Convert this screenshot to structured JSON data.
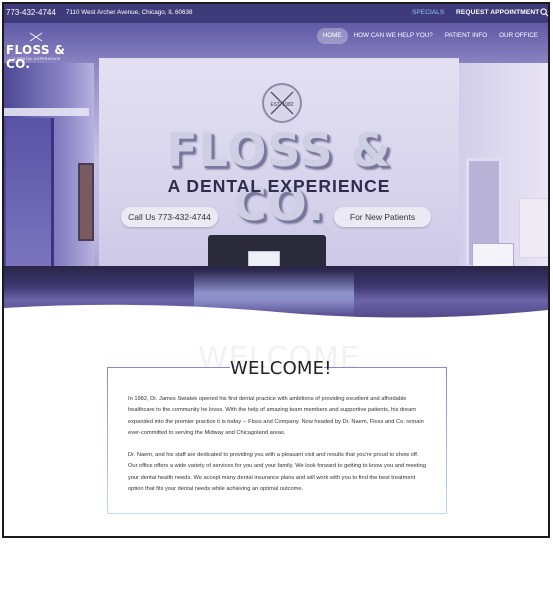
{
  "topbar": {
    "phone": "773-432-4744",
    "address": "7110 West Archer Avenue, Chicago, IL 60638",
    "specials": "SPECIALS",
    "request": "REQUEST APPOINTMENT",
    "specials_color": "#8fc4ff",
    "background": "#3f3a7a"
  },
  "brand": {
    "name": "FLOSS & CO.",
    "tagline": "A DENTAL EXPERIENCE",
    "badge_text": "EST. 1982"
  },
  "nav": {
    "items": [
      {
        "label": "HOME",
        "active": true
      },
      {
        "label": "HOW CAN WE HELP YOU?",
        "active": false
      },
      {
        "label": "PATIENT INFO",
        "active": false
      },
      {
        "label": "OUR OFFICE",
        "active": false
      }
    ]
  },
  "hero": {
    "emblem_text": "EST. 1982",
    "logo_text": "FLOSS & CO.",
    "tagline": "A DENTAL EXPERIENCE",
    "call_button": "Call Us 773-432-4744",
    "new_patients_button": "For New Patients"
  },
  "welcome": {
    "ghost_title": "WELCOME",
    "title": "WELCOME!",
    "paragraphs": [
      "In 1982, Dr. James Swiatek opened his first dental practice with ambitions of providing excellent and affordable healthcare to the community he loves. With the help of amazing team members and supportive patients, his dream expanded into the premier practice it is today -- Floss and Company. Now headed by Dr. Naem, Floss and Co. remain ever-committed to serving the Midway and Chicagoland areas.",
      "Dr. Naem, and his staff are dedicated to providing you with a pleasant visit and results that you're proud to show off. Our office offers a wide variety of services for you and your family. We look forward to getting to know you and meeting your dental health needs. We accept many dental insurance plans and will work with you to find the best treatment option that fits your dental needs while achieving an optimal outcome."
    ]
  }
}
